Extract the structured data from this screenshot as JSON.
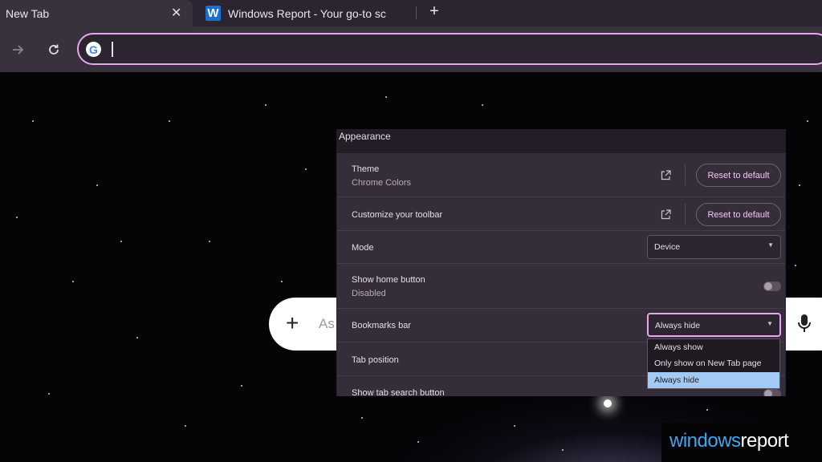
{
  "tabs": [
    {
      "title": "New Tab",
      "close": "✕"
    },
    {
      "title": "Windows Report - Your go-to sc",
      "favicon": "W"
    }
  ],
  "new_tab_button": "+",
  "toolbar": {
    "forward_icon": "forward-arrow-icon",
    "reload_icon": "reload-icon",
    "omnibox_value": "",
    "omnibox_logo": "G"
  },
  "search": {
    "plus": "+",
    "placeholder": "As"
  },
  "settings": {
    "section_title": "Appearance",
    "theme": {
      "label": "Theme",
      "value": "Chrome Colors",
      "reset": "Reset to default"
    },
    "toolbar": {
      "label": "Customize your toolbar",
      "reset": "Reset to default"
    },
    "mode": {
      "label": "Mode",
      "value": "Device"
    },
    "home_button": {
      "label": "Show home button",
      "status": "Disabled",
      "enabled": false
    },
    "bookmarks_bar": {
      "label": "Bookmarks bar",
      "value": "Always hide",
      "options": [
        "Always show",
        "Only show on New Tab page",
        "Always hide"
      ],
      "selected_index": 2
    },
    "tab_position": {
      "label": "Tab position"
    },
    "tab_search": {
      "label": "Show tab search button",
      "enabled": false
    }
  },
  "watermark": {
    "part1": "windows",
    "part2": "report"
  },
  "colors": {
    "accent": "#e7a6ee",
    "selected_option": "#a1cbf4",
    "panel": "#362d3a"
  }
}
